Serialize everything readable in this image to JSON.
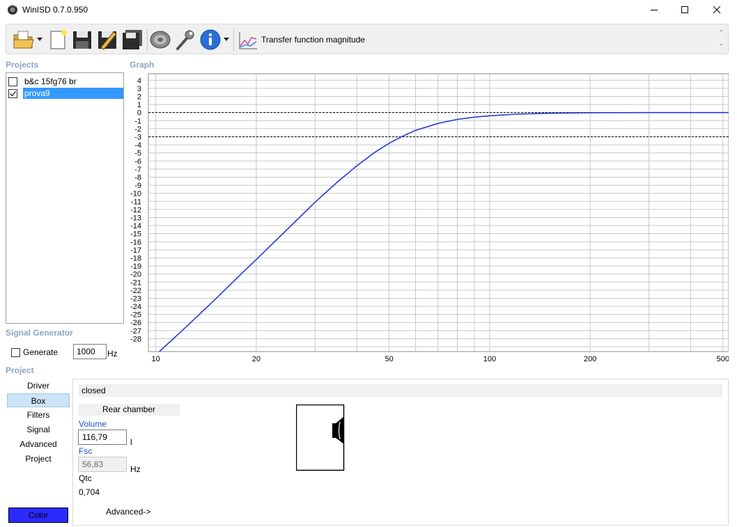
{
  "window": {
    "title": "WinISD 0.7.0.950"
  },
  "toolbar": {
    "graph_label": "Transfer function magnitude",
    "right_marks": [
      "-",
      "-"
    ]
  },
  "projects": {
    "title": "Projects",
    "items": [
      {
        "label": "b&c 15fg76 br",
        "checked": false,
        "selected": false
      },
      {
        "label": "prova9",
        "checked": true,
        "selected": true
      }
    ]
  },
  "graph": {
    "title": "Graph"
  },
  "chart_data": {
    "type": "line",
    "xscale": "log",
    "xlim": [
      9.5,
      520
    ],
    "ylim": [
      -29.6,
      4.8
    ],
    "xticks": [
      10,
      20,
      50,
      100,
      200,
      500
    ],
    "yticks": [
      4,
      3,
      2,
      1,
      0,
      -1,
      -2,
      -3,
      -4,
      -5,
      -6,
      -7,
      -8,
      -9,
      -10,
      -11,
      -12,
      -13,
      -14,
      -15,
      -16,
      -17,
      -18,
      -19,
      -20,
      -21,
      -22,
      -23,
      -24,
      -25,
      -26,
      -27,
      -28
    ],
    "reference_lines": [
      0,
      -3
    ],
    "series": [
      {
        "color": "#1f3bd6",
        "x": [
          9.7,
          10,
          12,
          15,
          18,
          20,
          25,
          30,
          35,
          40,
          45,
          50,
          55,
          60,
          70,
          80,
          90,
          100,
          120,
          150,
          200,
          300,
          500,
          520
        ],
        "y": [
          -30.6,
          -30.0,
          -27.0,
          -23.2,
          -20.0,
          -18.2,
          -14.3,
          -11.1,
          -8.6,
          -6.6,
          -5.0,
          -3.8,
          -2.9,
          -2.2,
          -1.35,
          -0.85,
          -0.57,
          -0.4,
          -0.2,
          -0.09,
          -0.03,
          0,
          0,
          0
        ]
      }
    ]
  },
  "signal_generator": {
    "title": "Signal Generator",
    "generate_label": "Generate",
    "frequency": "1000",
    "unit": "Hz"
  },
  "project_section": {
    "title": "Project",
    "nav": [
      "Driver",
      "Box",
      "Filters",
      "Signal",
      "Advanced",
      "Project"
    ],
    "active": "Box",
    "color_button": "Color"
  },
  "box_panel": {
    "type_header": "closed",
    "rear_chamber": "Rear chamber",
    "volume_label": "Volume",
    "volume_value": "116,79",
    "volume_unit": "l",
    "fsc_label": "Fsc",
    "fsc_value": "56,83",
    "fsc_unit": "Hz",
    "qtc_label": "Qtc",
    "qtc_value": "0,704",
    "advanced_link": "Advanced->"
  },
  "colors": {
    "accent": "#3399ff",
    "curve": "#1f3bd6",
    "color_button": "#2b2bff",
    "section_title": "#8ea4c0"
  }
}
